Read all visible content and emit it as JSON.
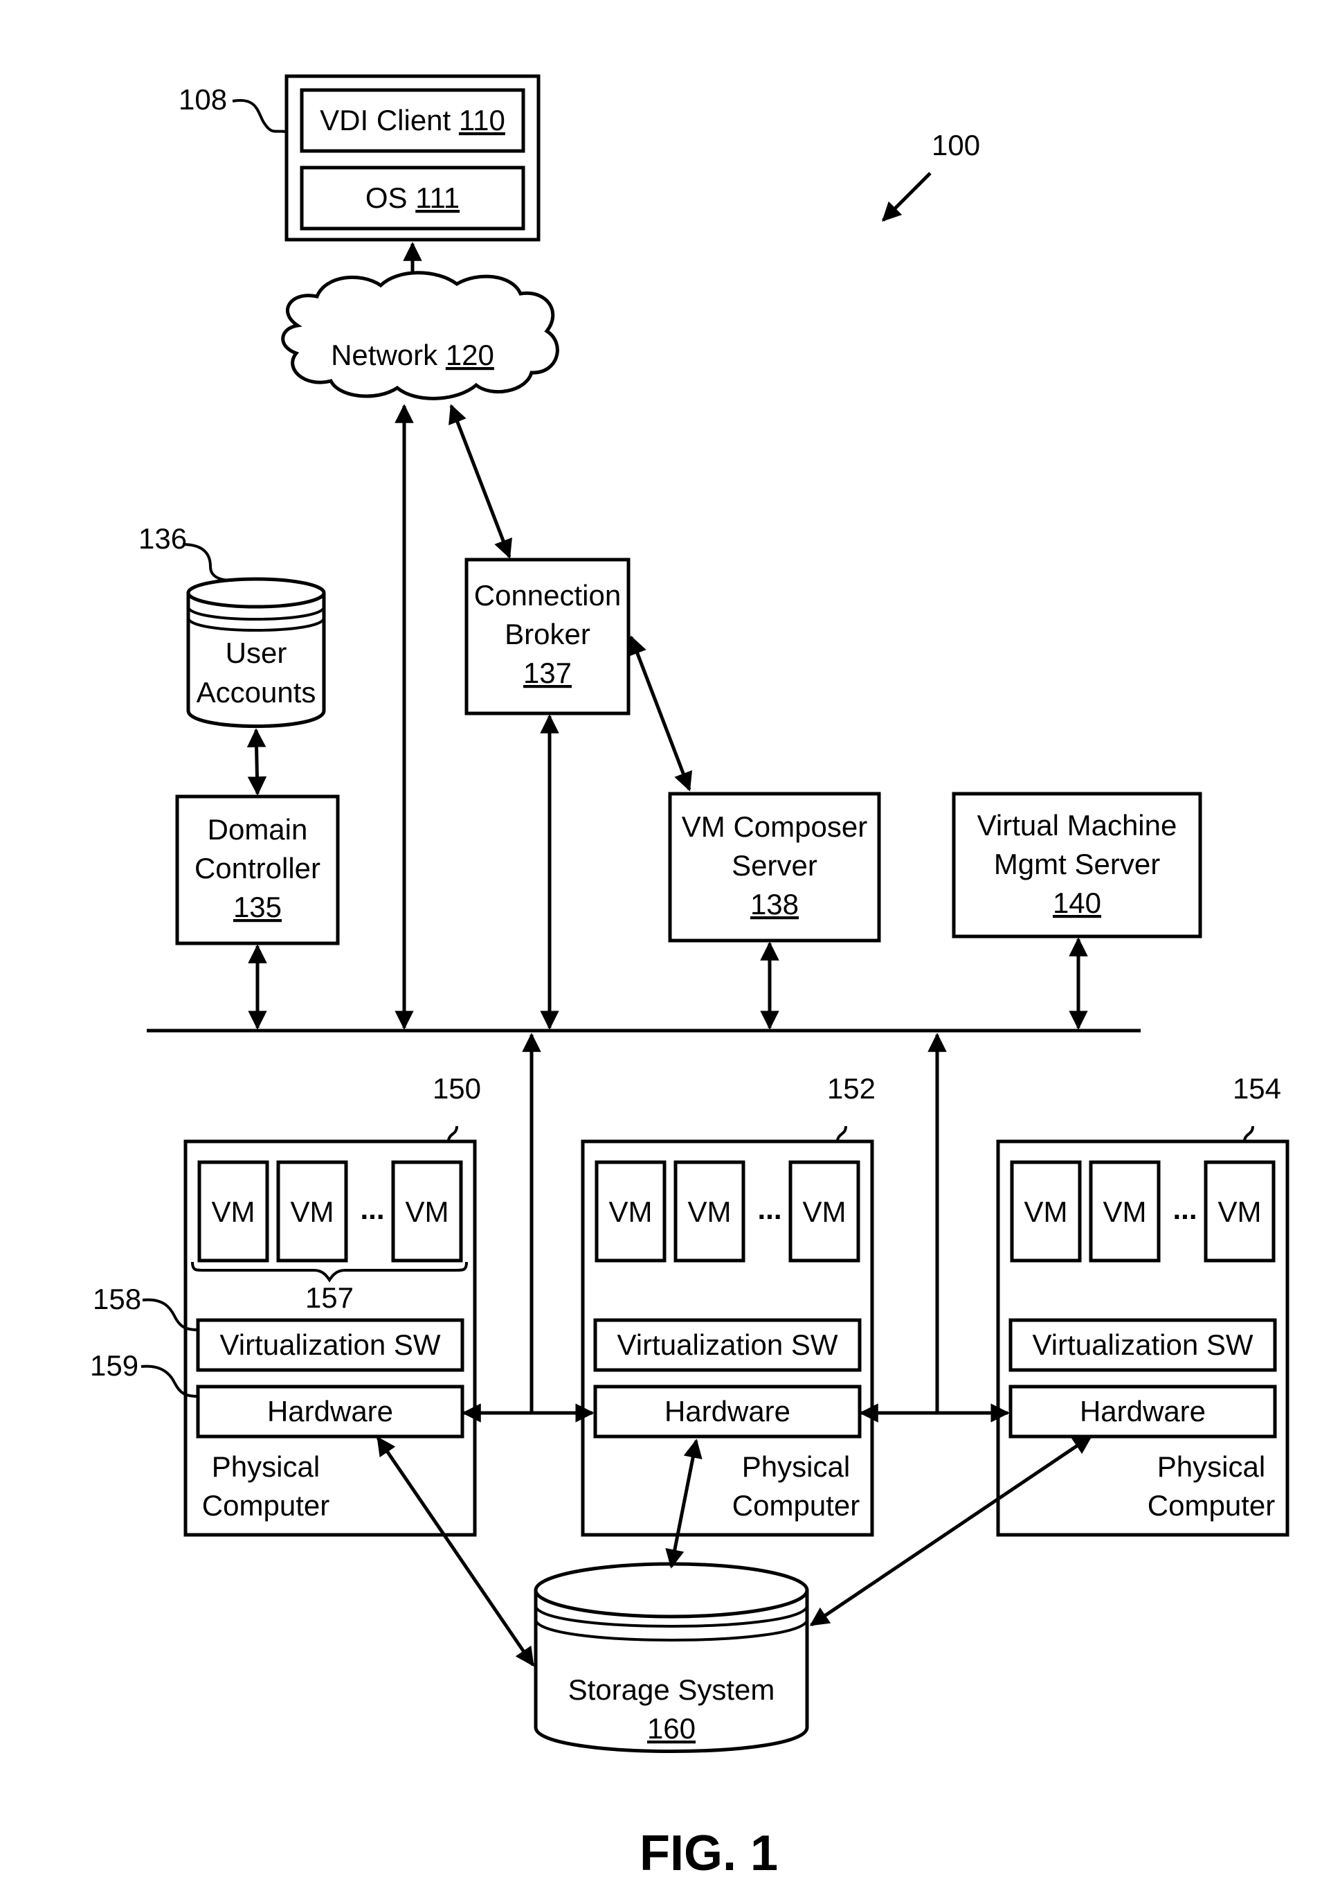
{
  "figure": {
    "figure_label": "FIG. 1",
    "system_ref": "100",
    "client": {
      "ref": "108",
      "vdi_client": {
        "label": "VDI Client",
        "ref": "110"
      },
      "os": {
        "label": "OS",
        "ref": "111"
      }
    },
    "network": {
      "label": "Network",
      "ref": "120"
    },
    "user_accounts": {
      "ref": "136",
      "line1": "User",
      "line2": "Accounts"
    },
    "domain_controller": {
      "line1": "Domain",
      "line2": "Controller",
      "ref": "135"
    },
    "connection_broker": {
      "line1": "Connection",
      "line2": "Broker",
      "ref": "137"
    },
    "vm_composer": {
      "line1": "VM Composer",
      "line2": "Server",
      "ref": "138"
    },
    "vm_mgmt": {
      "line1": "Virtual Machine",
      "line2": "Mgmt Server",
      "ref": "140"
    },
    "hosts": [
      {
        "ref": "150",
        "vm_label": "VM",
        "ellipsis": "...",
        "virt_label": "Virtualization SW",
        "hw_label": "Hardware",
        "line1": "Physical",
        "line2": "Computer"
      },
      {
        "ref": "152",
        "vm_label": "VM",
        "ellipsis": "...",
        "virt_label": "Virtualization SW",
        "hw_label": "Hardware",
        "line1": "Physical",
        "line2": "Computer"
      },
      {
        "ref": "154",
        "vm_label": "VM",
        "ellipsis": "...",
        "virt_label": "Virtualization SW",
        "hw_label": "Hardware",
        "line1": "Physical",
        "line2": "Computer"
      }
    ],
    "vm_group_ref": "157",
    "virt_sw_ref": "158",
    "hardware_ref": "159",
    "storage": {
      "label": "Storage System",
      "ref": "160"
    }
  }
}
